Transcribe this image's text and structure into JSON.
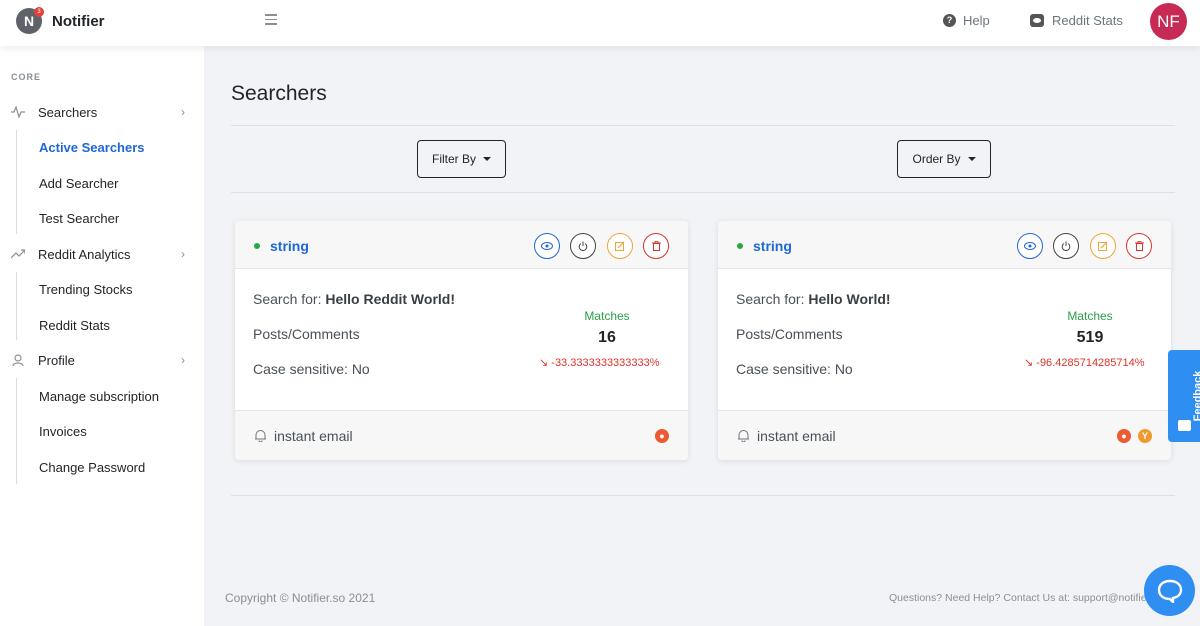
{
  "topnav": {
    "logo_letter": "N",
    "logo_badge": "3",
    "brand": "Notifier",
    "help_label": "Help",
    "stats_label": "Reddit Stats",
    "avatar_initials": "NF"
  },
  "sidebar": {
    "heading": "CORE",
    "sections": [
      {
        "label": "Searchers",
        "icon": "activity-icon",
        "children": [
          "Active Searchers",
          "Add Searcher",
          "Test Searcher"
        ]
      },
      {
        "label": "Reddit Analytics",
        "icon": "trending-up-icon",
        "children": [
          "Trending Stocks",
          "Reddit Stats"
        ]
      },
      {
        "label": "Profile",
        "icon": "user-icon",
        "children": [
          "Manage subscription",
          "Invoices",
          "Change Password"
        ]
      }
    ],
    "active_item": "Active Searchers"
  },
  "main": {
    "title": "Searchers",
    "filter_label": "Filter By",
    "order_label": "Order By"
  },
  "cards": [
    {
      "name": "string",
      "search_prefix": "Search for: ",
      "search_term": "Hello Reddit World!",
      "type": "Posts/Comments",
      "case": "Case sensitive: No",
      "matches_label": "Matches",
      "matches_count": "16",
      "change": "-33.3333333333333%",
      "footer_text": "instant email",
      "sources": [
        "reddit"
      ]
    },
    {
      "name": "string",
      "search_prefix": "Search for: ",
      "search_term": "Hello World!",
      "type": "Posts/Comments",
      "case": "Case sensitive: No",
      "matches_label": "Matches",
      "matches_count": "519",
      "change": "-96.4285714285714%",
      "footer_text": "instant email",
      "sources": [
        "reddit",
        "ycombinator"
      ]
    }
  ],
  "feedback_label": "Feedback",
  "footer": {
    "copyright": "Copyright © Notifier.so 2021",
    "help": "Questions? Need Help? Contact Us at: support@notifier.so"
  },
  "colors": {
    "accent": "#1f67d6",
    "positive": "#2aa04a",
    "negative": "#d9342b",
    "avatar": "#c62a55"
  }
}
